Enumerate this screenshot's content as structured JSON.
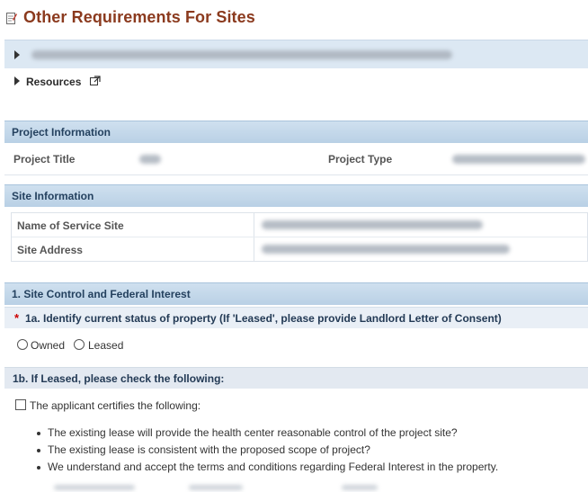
{
  "page": {
    "title": "Other Requirements For Sites",
    "title_icon": "document-edit-icon"
  },
  "collapsibles": {
    "resources_label": "Resources",
    "resources_icon": "external-link-icon"
  },
  "project_information": {
    "header": "Project Information",
    "project_title_label": "Project Title",
    "project_type_label": "Project Type"
  },
  "site_information": {
    "header": "Site Information",
    "service_site_label": "Name of Service Site",
    "site_address_label": "Site Address"
  },
  "site_control": {
    "header": "1. Site Control and Federal Interest",
    "question_1a": "1a. Identify current status of property (If 'Leased', please provide Landlord Letter of Consent)",
    "required_marker": "*",
    "options": [
      "Owned",
      "Leased"
    ],
    "question_1b": "1b. If Leased, please check the following:",
    "certify_label": "The applicant certifies the following:",
    "certify_items": [
      "The existing lease will provide the health center reasonable control of the project site?",
      "The existing lease is consistent with the proposed scope of project?",
      "We understand and accept the terms and conditions regarding Federal Interest in the property."
    ]
  },
  "colors": {
    "title": "#8b3a1e",
    "section_header_text": "#24415f",
    "required": "#cc0000"
  }
}
